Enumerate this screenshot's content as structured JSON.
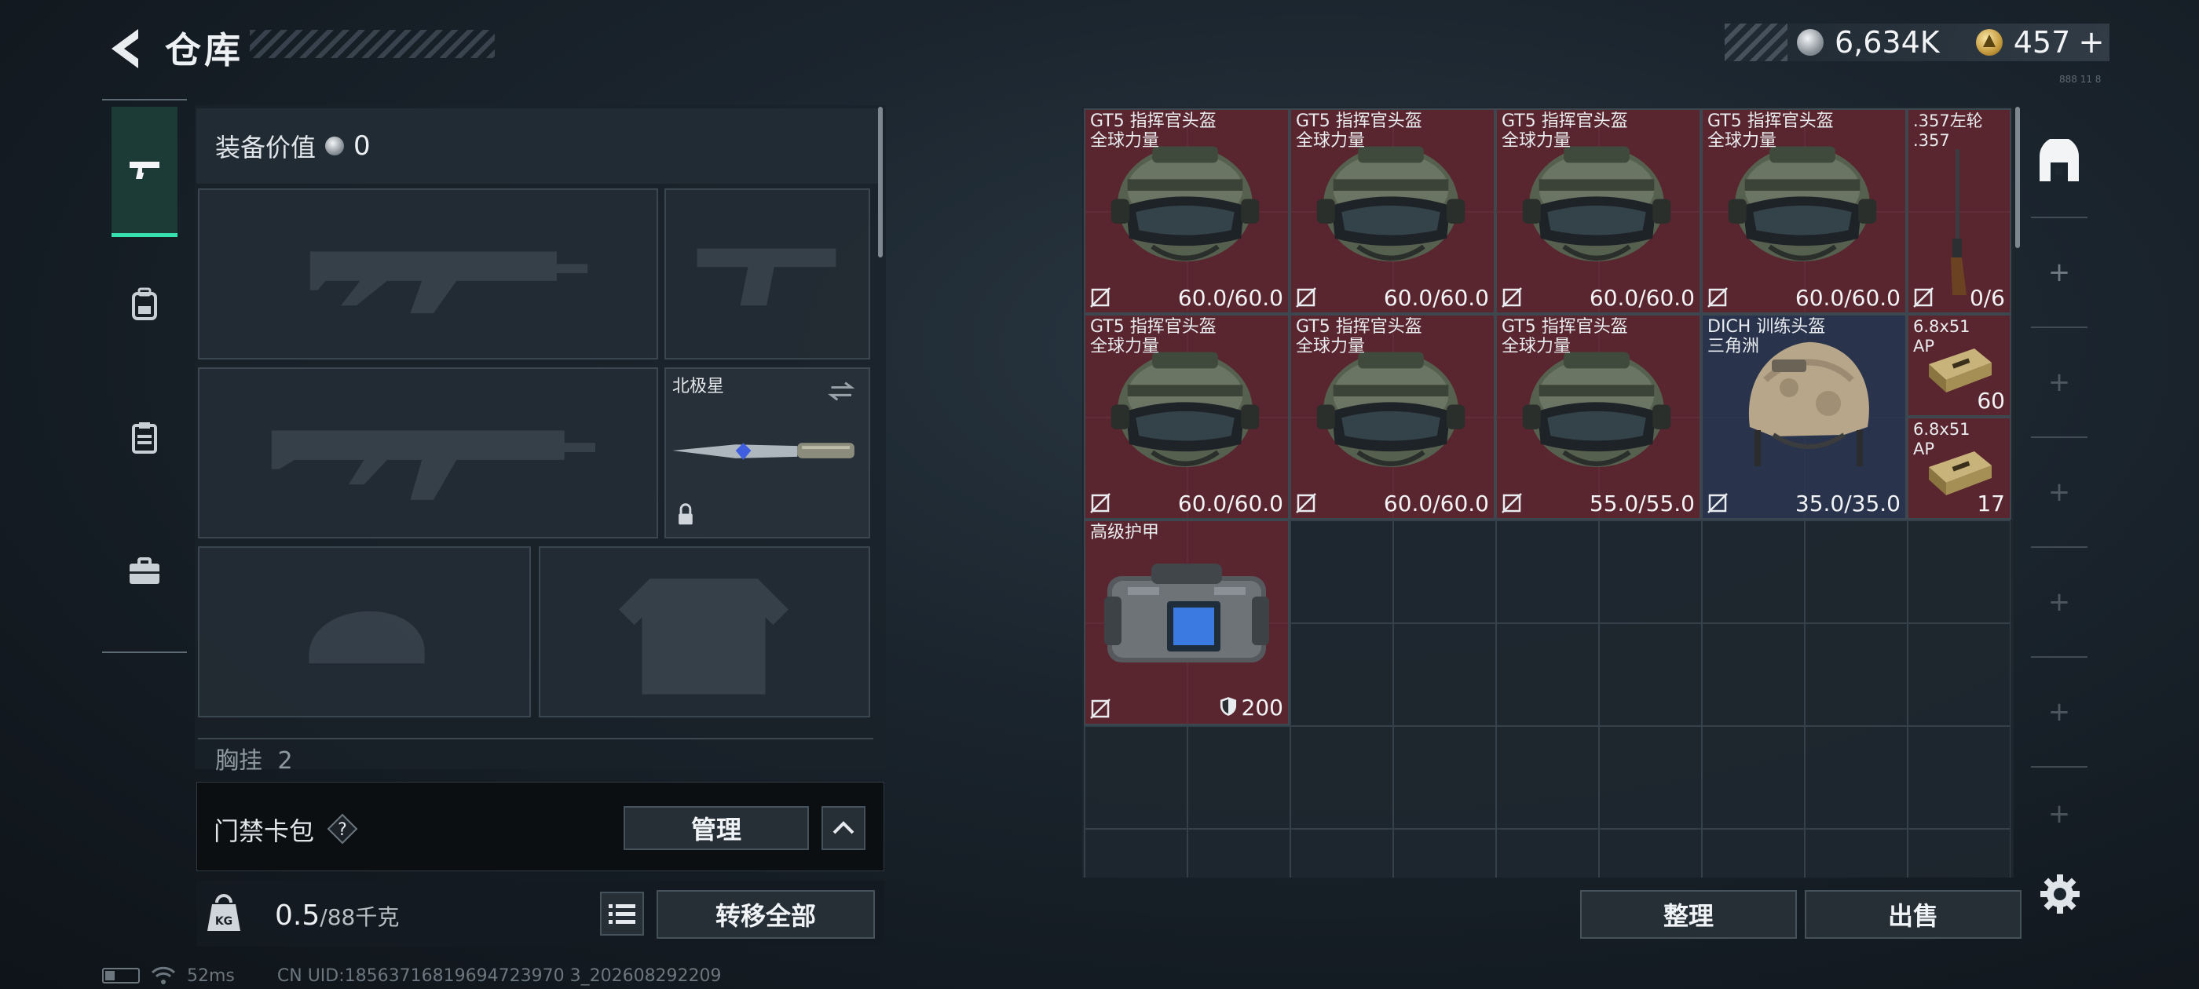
{
  "header": {
    "title": "仓库",
    "currencies": [
      {
        "icon": "silver-coin-icon",
        "value": "6,634K"
      },
      {
        "icon": "gold-coin-icon",
        "value": "457",
        "suffix": "+"
      }
    ],
    "corner_text": "888 11 8"
  },
  "left_nav": {
    "items": [
      {
        "name": "weapons",
        "icon": "pistol-icon",
        "active": true
      },
      {
        "name": "backpack",
        "icon": "backpack-icon",
        "active": false
      },
      {
        "name": "container",
        "icon": "clipboard-icon",
        "active": false
      },
      {
        "name": "case",
        "icon": "briefcase-icon",
        "active": false
      }
    ]
  },
  "equipment": {
    "value_label": "装备价值",
    "value": "0",
    "knife_slot_label": "北极星",
    "chest_label": "胸挂",
    "chest_count": "2"
  },
  "keycard": {
    "label": "门禁卡包",
    "help": "?",
    "manage_label": "管理"
  },
  "weight": {
    "current": "0.5",
    "max": "/88千克",
    "transfer_label": "转移全部"
  },
  "status": {
    "ping": "52ms",
    "uid": "CN UID:18563716819694723970 3_202608292209"
  },
  "stash": {
    "items": [
      {
        "line1": "GT5 指挥官头盔",
        "line2": "全球力量",
        "value": "60.0/60.0",
        "type": "helmet-green"
      },
      {
        "line1": "GT5 指挥官头盔",
        "line2": "全球力量",
        "value": "60.0/60.0",
        "type": "helmet-green"
      },
      {
        "line1": "GT5 指挥官头盔",
        "line2": "全球力量",
        "value": "60.0/60.0",
        "type": "helmet-green"
      },
      {
        "line1": "GT5 指挥官头盔",
        "line2": "全球力量",
        "value": "60.0/60.0",
        "type": "helmet-green"
      },
      {
        "line1": ".357左轮",
        "line2": ".357",
        "value": "0/6",
        "type": "revolver"
      },
      {
        "line1": "GT5 指挥官头盔",
        "line2": "全球力量",
        "value": "60.0/60.0",
        "type": "helmet-green"
      },
      {
        "line1": "GT5 指挥官头盔",
        "line2": "全球力量",
        "value": "60.0/60.0",
        "type": "helmet-green"
      },
      {
        "line1": "GT5 指挥官头盔",
        "line2": "全球力量",
        "value": "55.0/55.0",
        "type": "helmet-green"
      },
      {
        "line1": "DICH 训练头盔",
        "line2": "三角洲",
        "value": "35.0/35.0",
        "type": "helmet-tan"
      },
      {
        "line1": "6.8x51",
        "line2": "AP",
        "value": "60",
        "type": "ammo"
      },
      {
        "line1": "6.8x51",
        "line2": "AP",
        "value": "17",
        "type": "ammo"
      },
      {
        "line1": "高级护甲",
        "line2": "",
        "value": "200",
        "type": "armor"
      }
    ],
    "sort_label": "整理",
    "sell_label": "出售"
  },
  "colors": {
    "accent": "#36e0b0",
    "item_red": "#6e2630",
    "item_blue": "#2c3650"
  }
}
